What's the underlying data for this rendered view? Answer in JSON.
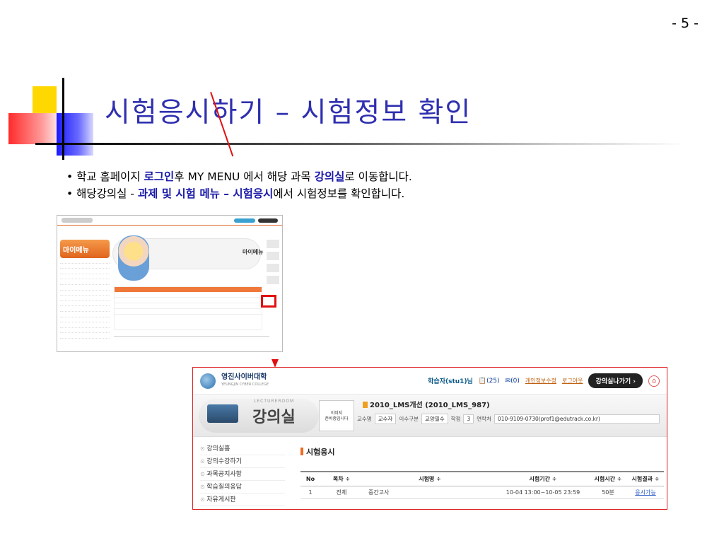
{
  "slide": {
    "page_number": "- 5 -",
    "title": "시험응시하기 – 시험정보 확인",
    "bullets": [
      {
        "p1": "학교 홈페이지 ",
        "h1": "로그인",
        "p2": "후 MY MENU 에서 해당 과목 ",
        "h2": "강의실",
        "p3": "로 이동합니다."
      },
      {
        "p1": "해당강의실 - ",
        "h1": "과제 및 시험 메뉴 – 시험응시",
        "p2": "에서 시험정보를 확인합니다."
      }
    ]
  },
  "small_shot": {
    "side_title": "마이메뉴",
    "banner_title": "마이메뉴"
  },
  "portal": {
    "logo": "영진사이버대학",
    "logo_sub": "YEUNGJIN CYBER COLLEGE",
    "user": "학습자(stu1)님",
    "notes": "(25)",
    "messages": "(0)",
    "link_profile": "개인정보수정",
    "link_logout": "로그아웃",
    "go_button": "강의실나가기 ›",
    "home_icon": "home-icon",
    "lecture_small": "LECTUREROOM",
    "lecture_big": "강의실",
    "image_placeholder": "이미지\n준비중입니다",
    "course_name": "2010_LMS개선 (2010_LMS_987)",
    "info": {
      "instructor_label": "교수명",
      "instructor": "교수자",
      "type_label": "이수구분",
      "type": "교양필수",
      "credit_label": "학점",
      "credit": "3",
      "contact_label": "연락처",
      "contact": "010-9109-0730(prof1@edutrack.co.kr)"
    },
    "sidebar": [
      "강의실홈",
      "강의수강하기",
      "과목공지사항",
      "학습질의응답",
      "자유게시판"
    ],
    "section_title": "시험응시",
    "table": {
      "headers": [
        "No",
        "목차 ÷",
        "시험명 ÷",
        "시험기간 ÷",
        "시험시간 ÷",
        "시험결과 ÷"
      ],
      "rows": [
        {
          "no": "1",
          "toc": "전체",
          "name": "중간고사",
          "period": "10-04 13:00~10-05 23:59",
          "time": "50분",
          "result": "응시가능"
        }
      ]
    }
  }
}
